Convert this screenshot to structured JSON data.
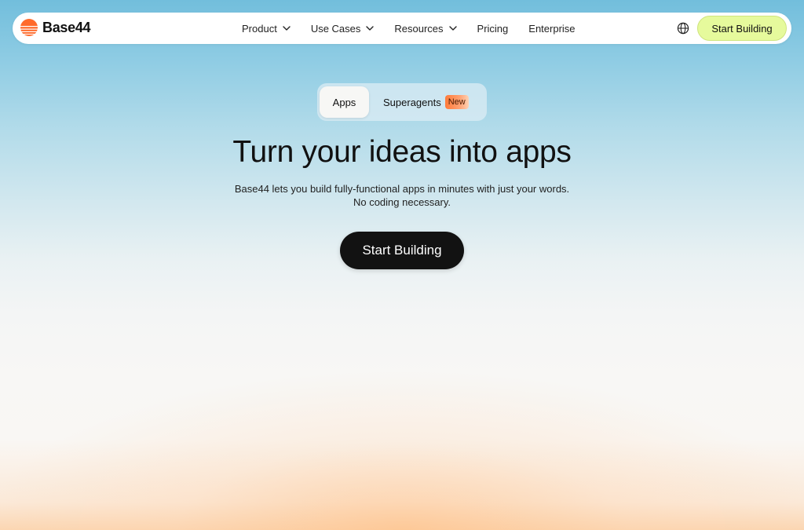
{
  "brand": {
    "name": "Base44",
    "logo_icon": "sunset-stripes-icon",
    "accent_color": "#ff6a2b"
  },
  "nav": {
    "items": [
      {
        "label": "Product",
        "has_dropdown": true
      },
      {
        "label": "Use Cases",
        "has_dropdown": true
      },
      {
        "label": "Resources",
        "has_dropdown": true
      },
      {
        "label": "Pricing",
        "has_dropdown": false
      },
      {
        "label": "Enterprise",
        "has_dropdown": false
      }
    ],
    "language_icon": "globe-icon",
    "cta_label": "Start Building",
    "cta_color": "#e6fa9c"
  },
  "toggle": {
    "apps_label": "Apps",
    "superagents_label": "Superagents",
    "new_badge": "New",
    "selected": "Apps"
  },
  "hero": {
    "title": "Turn your ideas into apps",
    "subtitle_line1": "Base44 lets you build fully-functional apps in minutes with just your words.",
    "subtitle_line2": "No coding necessary.",
    "cta_label": "Start Building",
    "cta_color": "#121212"
  }
}
